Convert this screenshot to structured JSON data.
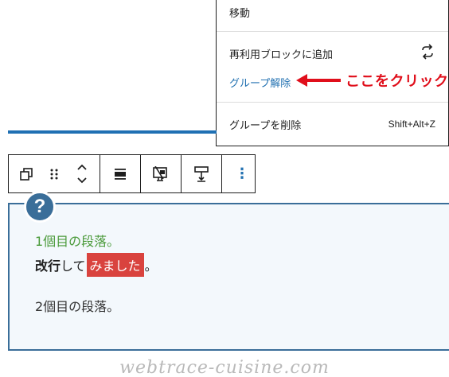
{
  "menu": {
    "move_label": "移動",
    "add_reusable_label": "再利用ブロックに追加",
    "ungroup_label": "グループ解除",
    "delete_group_label": "グループを削除",
    "delete_shortcut": "Shift+Alt+Z",
    "accent_link_color": "#2271b1"
  },
  "callout": {
    "text": "ここをクリック",
    "color": "#e00f1b"
  },
  "toolbar": {
    "buttons": [
      "copy-blocks-icon",
      "drag-handle-icon",
      "move-up-icon",
      "move-down-icon",
      "align-icon",
      "image-toggle-icon",
      "format-icon",
      "more-options-icon"
    ],
    "more_glyph": "⋮"
  },
  "content": {
    "badge": "?",
    "paragraph1": "1個目の段落。",
    "line2_bold": "改行",
    "line2_text": "して",
    "line2_highlight": "みました",
    "line2_end": "。",
    "paragraph2": "2個目の段落。",
    "paragraph1_color": "#4a9a3a",
    "highlight_color": "#d9433e"
  },
  "watermark": "webtrace-cuisine.com"
}
